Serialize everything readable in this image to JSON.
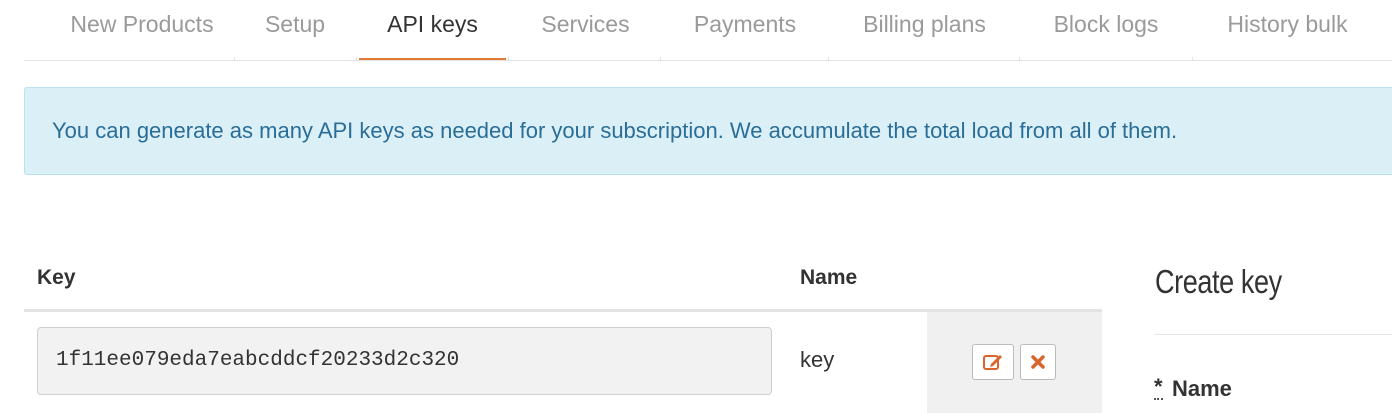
{
  "tabs": [
    {
      "label": "New Products",
      "active": false
    },
    {
      "label": "Setup",
      "active": false
    },
    {
      "label": "API keys",
      "active": true
    },
    {
      "label": "Services",
      "active": false
    },
    {
      "label": "Payments",
      "active": false
    },
    {
      "label": "Billing plans",
      "active": false
    },
    {
      "label": "Block logs",
      "active": false
    },
    {
      "label": "History bulk",
      "active": false
    }
  ],
  "alert": {
    "text": "You can generate as many API keys as needed for your subscription. We accumulate the total load from all of them."
  },
  "table": {
    "headers": {
      "key": "Key",
      "name": "Name"
    },
    "rows": [
      {
        "key": "1f11ee079eda7eabcddcf20233d2c320",
        "name": "key",
        "actions": [
          "edit-icon",
          "delete-icon"
        ]
      }
    ]
  },
  "create_form": {
    "title": "Create key",
    "required_mark": "*",
    "name_label": "Name"
  },
  "colors": {
    "accent": "#e07b39",
    "alert_bg": "#dbeff7",
    "alert_text": "#2a6e97",
    "delete": "#d9652b"
  }
}
